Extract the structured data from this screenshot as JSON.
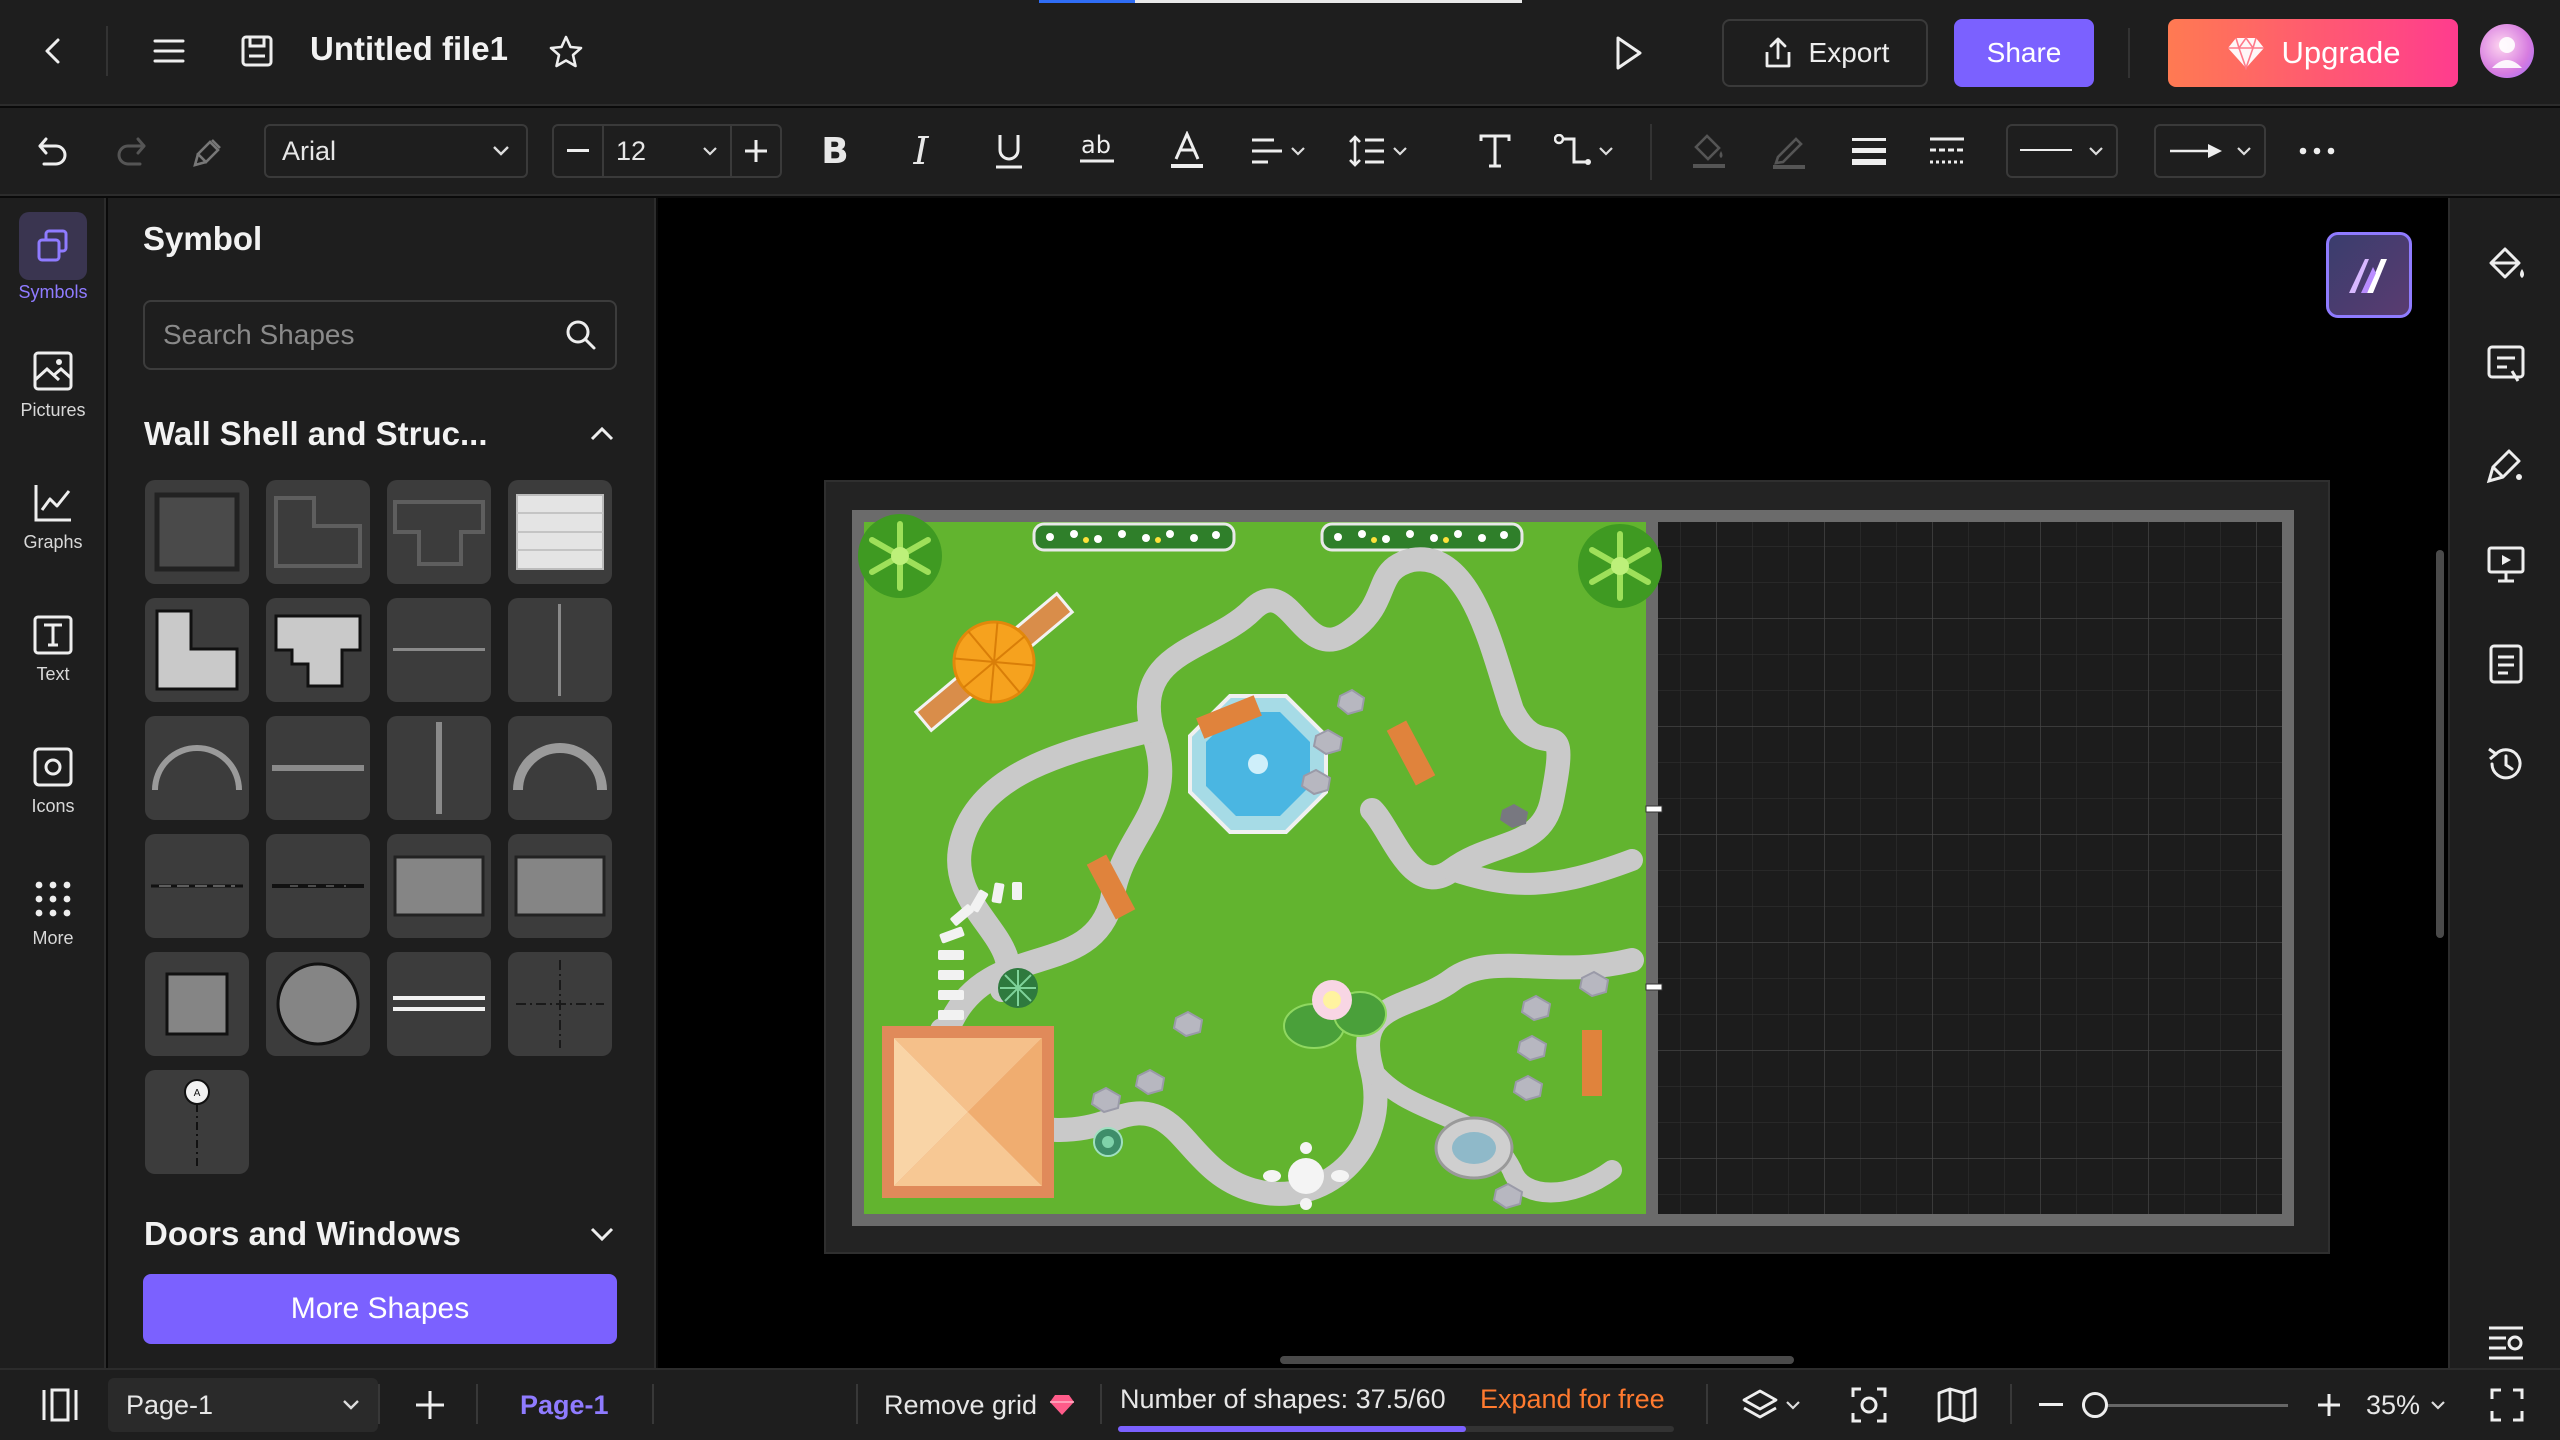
{
  "header": {
    "title": "Untitled file1",
    "export_label": "Export",
    "share_label": "Share",
    "upgrade_label": "Upgrade"
  },
  "toolbar": {
    "font_family": "Arial",
    "font_size": "12"
  },
  "left_rail": {
    "items": [
      {
        "label": "Symbols",
        "icon": "symbols-icon",
        "active": true
      },
      {
        "label": "Pictures",
        "icon": "pictures-icon"
      },
      {
        "label": "Graphs",
        "icon": "graphs-icon"
      },
      {
        "label": "Text",
        "icon": "text-icon"
      },
      {
        "label": "Icons",
        "icon": "icons-icon"
      },
      {
        "label": "More",
        "icon": "more-grid-icon"
      }
    ]
  },
  "panel": {
    "title": "Symbol",
    "search_placeholder": "Search Shapes",
    "section1_title": "Wall Shell and Struc...",
    "section2_title": "Doors and Windows",
    "more_shapes_label": "More Shapes"
  },
  "status": {
    "page_select": "Page-1",
    "page_tab": "Page-1",
    "remove_grid": "Remove grid",
    "shape_count": "Number of shapes: 37.5/60",
    "shape_progress": 0.625,
    "expand": "Expand for free",
    "zoom": "35%"
  },
  "colors": {
    "accent": "#7b61ff",
    "upgrade_start": "#ff7a52",
    "upgrade_end": "#ff3c8e",
    "grass": "#62b42f",
    "expand": "#ff7a2f"
  }
}
